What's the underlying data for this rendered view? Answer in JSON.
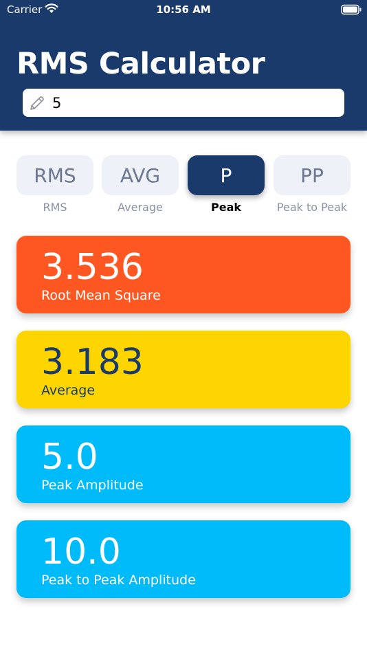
{
  "status_bar": {
    "carrier": "Carrier",
    "time": "10:56 AM"
  },
  "header": {
    "title": "RMS Calculator"
  },
  "input": {
    "value": "5"
  },
  "segments": [
    {
      "short": "RMS",
      "label": "RMS",
      "active": false
    },
    {
      "short": "AVG",
      "label": "Average",
      "active": false
    },
    {
      "short": "P",
      "label": "Peak",
      "active": true
    },
    {
      "short": "PP",
      "label": "Peak to Peak",
      "active": false
    }
  ],
  "results": [
    {
      "value": "3.536",
      "label": "Root Mean Square",
      "bg": "#ff5722",
      "fg": "#ffffff"
    },
    {
      "value": "3.183",
      "label": "Average",
      "bg": "#ffd500",
      "fg": "#1a3a6b"
    },
    {
      "value": "5.0",
      "label": "Peak Amplitude",
      "bg": "#00bbf9",
      "fg": "#ffffff"
    },
    {
      "value": "10.0",
      "label": "Peak to Peak Amplitude",
      "bg": "#00bbf9",
      "fg": "#ffffff"
    }
  ],
  "colors": {
    "header_bg": "#1a3a6b",
    "segment_bg": "#eef1f8",
    "segment_text": "#6b7690"
  },
  "icons": {
    "wifi": "wifi-icon",
    "battery": "battery-icon",
    "edit": "pencil-icon"
  }
}
